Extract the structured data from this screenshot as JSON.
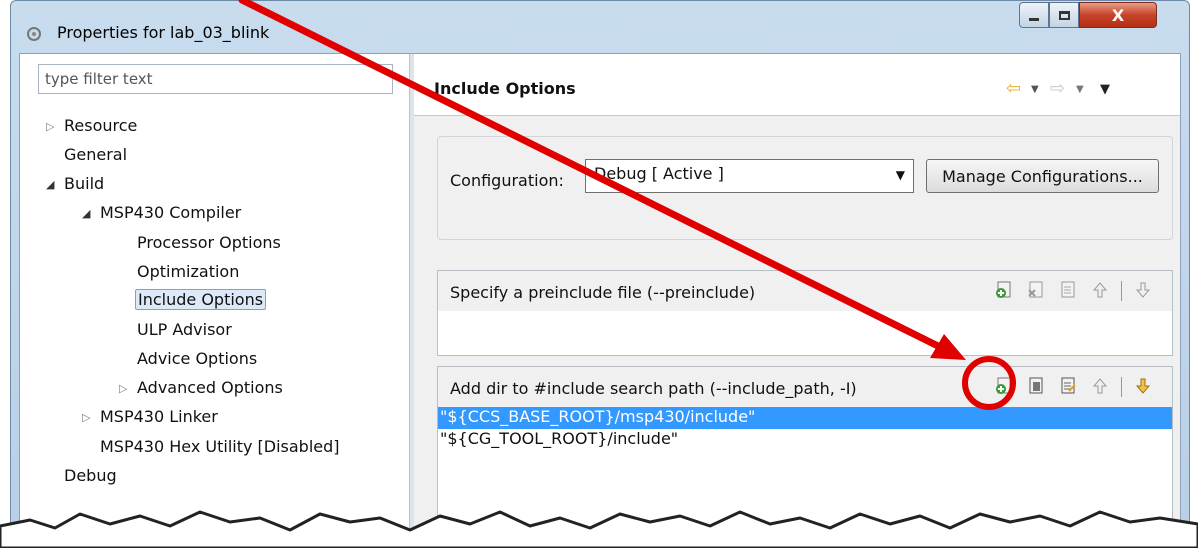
{
  "window": {
    "title": "Properties for lab_03_blink"
  },
  "filter": {
    "placeholder": "type filter text"
  },
  "tree": {
    "resource": "Resource",
    "general": "General",
    "build": "Build",
    "compiler": "MSP430 Compiler",
    "processor_options": "Processor Options",
    "optimization": "Optimization",
    "include_options": "Include Options",
    "ulp_advisor": "ULP Advisor",
    "advice_options": "Advice Options",
    "advanced_options": "Advanced Options",
    "linker": "MSP430 Linker",
    "hex_utility": "MSP430 Hex Utility  [Disabled]",
    "debug": "Debug"
  },
  "header": {
    "title": "Include Options"
  },
  "config": {
    "label": "Configuration:",
    "selected": "Debug  [ Active ]",
    "manage_label": "Manage Configurations..."
  },
  "preinclude": {
    "title": "Specify a preinclude file (--preinclude)"
  },
  "include_path": {
    "title": "Add dir to #include search path (--include_path, -I)",
    "items": [
      "\"${CCS_BASE_ROOT}/msp430/include\"",
      "\"${CG_TOOL_ROOT}/include\""
    ]
  },
  "colors": {
    "selection": "#3399ff",
    "annotation": "#e00000",
    "nav_arrow": "#e8b030"
  },
  "icons": {
    "add": "add-icon",
    "delete": "delete-icon",
    "edit": "edit-icon",
    "move_up": "move-up-icon",
    "move_down": "move-down-icon",
    "back": "back-arrow-icon",
    "forward": "forward-arrow-icon"
  }
}
